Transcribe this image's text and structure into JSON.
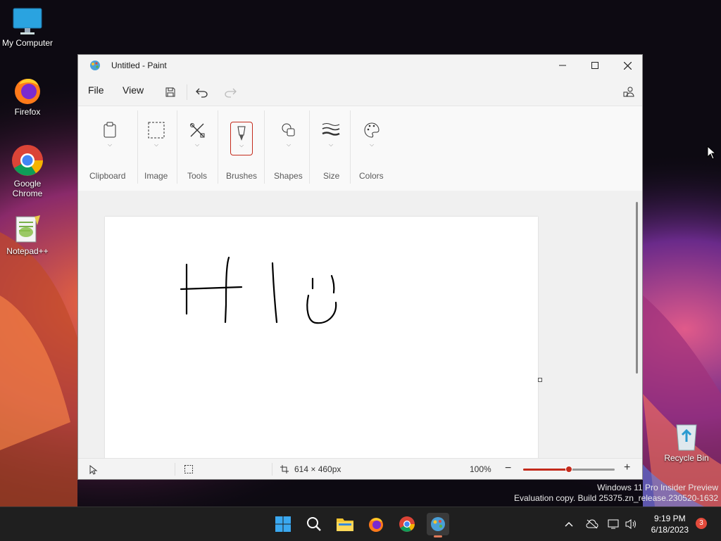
{
  "desktop": {
    "icons": [
      {
        "label": "My Computer"
      },
      {
        "label": "Firefox"
      },
      {
        "label": "Google Chrome"
      },
      {
        "label": "Notepad++"
      },
      {
        "label": "Recycle Bin"
      }
    ],
    "watermark_line1": "Windows 11 Pro Insider Preview",
    "watermark_line2": "Evaluation copy. Build 25375.zn_release.230520-1632"
  },
  "window": {
    "title": "Untitled - Paint",
    "menu": {
      "file": "File",
      "view": "View"
    },
    "ribbon": {
      "groups": [
        {
          "label": "Clipboard",
          "icon": "clipboard-icon"
        },
        {
          "label": "Image",
          "icon": "selection-icon"
        },
        {
          "label": "Tools",
          "icon": "tools-icon"
        },
        {
          "label": "Brushes",
          "icon": "brush-icon"
        },
        {
          "label": "Shapes",
          "icon": "shapes-icon"
        },
        {
          "label": "Size",
          "icon": "size-icon"
        },
        {
          "label": "Colors",
          "icon": "palette-icon"
        }
      ]
    },
    "status": {
      "canvas_size": "614 × 460px",
      "zoom": "100%",
      "zoom_fraction": 0.5
    },
    "colors": {
      "accent": "#c42b1c",
      "selected_border": "#c42b1c"
    }
  },
  "taskbar": {
    "time": "9:19 PM",
    "date": "6/18/2023",
    "notifications": "3"
  }
}
